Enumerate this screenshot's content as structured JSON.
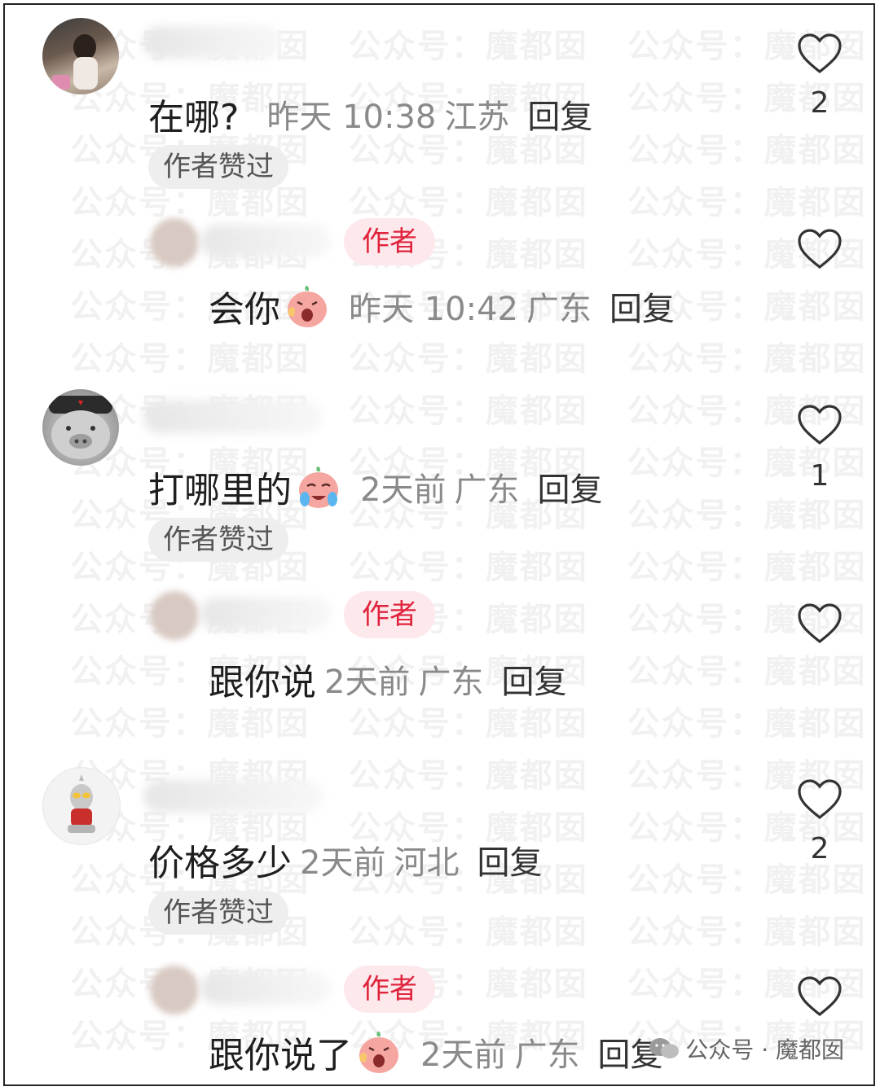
{
  "watermark_text": "公众号：魔都囡",
  "author_tag": "作者",
  "liked_tag": "作者赞过",
  "reply_label": "回复",
  "comments": [
    {
      "text": "在哪?",
      "time": "昨天 10:38",
      "location": "江苏",
      "likes": "2",
      "author_liked": true
    },
    {
      "text": "会你",
      "time": "昨天 10:42",
      "location": "广东",
      "likes": "",
      "is_author": true,
      "emoji": "surprised-face-icon"
    },
    {
      "text": "打哪里的",
      "time": "2天前",
      "location": "广东",
      "likes": "1",
      "author_liked": true,
      "emoji": "crying-face-icon"
    },
    {
      "text": "跟你说",
      "time": "2天前",
      "location": "广东",
      "likes": "",
      "is_author": true
    },
    {
      "text": "价格多少",
      "time": "2天前",
      "location": "河北",
      "likes": "2",
      "author_liked": true
    },
    {
      "text": "跟你说了",
      "time": "2天前",
      "location": "广东",
      "likes": "",
      "is_author": true,
      "emoji": "surprised-face-icon"
    }
  ],
  "footer": {
    "label": "公众号 · 魔都囡"
  }
}
